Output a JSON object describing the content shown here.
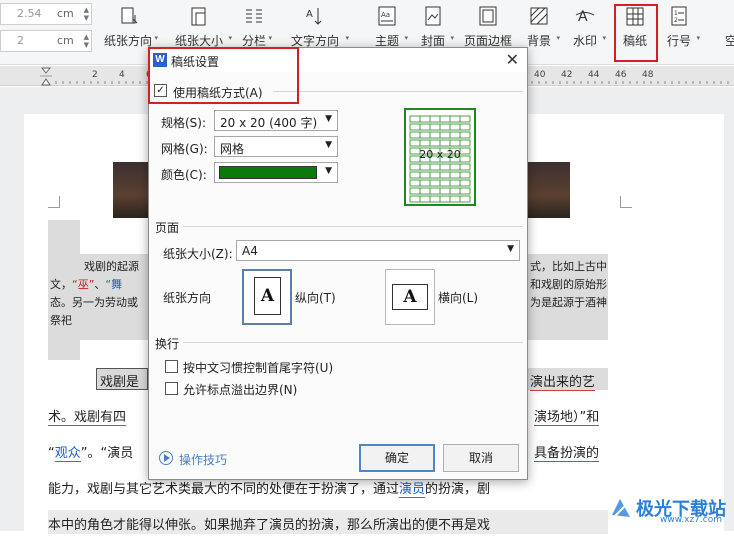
{
  "ribbon": {
    "spin1": {
      "value": "2.54",
      "unit": "cm"
    },
    "spin2": {
      "value": "2",
      "unit": "cm"
    },
    "tools": [
      {
        "label": "纸张方向",
        "icon": "page-orientation-icon",
        "dd": true
      },
      {
        "label": "纸张大小",
        "icon": "page-size-icon",
        "dd": true
      },
      {
        "label": "分栏",
        "icon": "columns-icon",
        "dd": true
      },
      {
        "label": "文字方向",
        "icon": "text-direction-icon",
        "dd": true
      },
      {
        "label": "主题",
        "icon": "theme-icon",
        "dd": true
      },
      {
        "label": "封面",
        "icon": "cover-page-icon",
        "dd": true
      },
      {
        "label": "页面边框",
        "icon": "page-border-icon",
        "dd": false
      },
      {
        "label": "背景",
        "icon": "background-icon",
        "dd": true
      },
      {
        "label": "水印",
        "icon": "watermark-icon",
        "dd": true
      },
      {
        "label": "稿纸",
        "icon": "manuscript-grid-icon",
        "dd": false
      },
      {
        "label": "行号",
        "icon": "line-numbers-icon",
        "dd": true
      },
      {
        "label": "空",
        "icon": "",
        "dd": false
      }
    ]
  },
  "ruler": {
    "numbers_left": [
      "2",
      "4",
      "6",
      "8"
    ],
    "numbers_right": [
      "40",
      "42",
      "44",
      "46",
      "48"
    ]
  },
  "document": {
    "para1_l1_a": "戏剧的起源",
    "para1_l1_b": "式，比如上古中",
    "para1_l2_a": "文，",
    "para1_l2_q1": "“巫”",
    "para1_l2_mid": "、",
    "para1_l2_q2": "“舞",
    "para1_l2_b": "和戏剧的原始形",
    "para1_l3_a": "态。另一为劳动或",
    "para1_l3_b": "为是起源于酒神",
    "para1_l4": "祭祀",
    "line1_a": "戏剧是",
    "line1_b": "演出来的艺",
    "line2_a": "术。戏剧有四",
    "line2_b": "演场地）”和",
    "line3_link": "观众",
    "line3_a": "“",
    "line3_b": "”。“演员",
    "line3_c": "具备扮演的",
    "line4_a": "能力，戏剧与其它艺术类最大的不同的处便在于扮演了，通过",
    "line4_link": "演员",
    "line4_b": "的扮演，剧",
    "line5": "本中的角色才能得以伸张。如果抛弃了演员的扮演，那么所演出的便不再是戏"
  },
  "dialog": {
    "title": "稿纸设置",
    "use_manuscript_label": "使用稿纸方式(A)",
    "use_manuscript_checked": true,
    "spec_label": "规格(S):",
    "spec_value": "20 x 20 (400 字)",
    "grid_label": "网格(G):",
    "grid_value": "网格",
    "color_label": "颜色(C):",
    "color_value": "#0a7a0a",
    "preview_label": "20 x 20",
    "page_section": "页面",
    "paper_size_label": "纸张大小(Z):",
    "paper_size_value": "A4",
    "orientation_label": "纸张方向",
    "portrait_icon_letter": "A",
    "portrait_label": "纵向(T)",
    "landscape_icon_letter": "A",
    "landscape_label": "横向(L)",
    "wrap_section": "换行",
    "opt1_label": "按中文习惯控制首尾字符(U)",
    "opt2_label": "允许标点溢出边界(N)",
    "tips_label": "操作技巧",
    "ok_label": "确定",
    "cancel_label": "取消"
  },
  "watermark": {
    "text": "极光下载站",
    "url": "www.xz7.com"
  },
  "colors": {
    "accent_red": "#d42020",
    "link_blue": "#1a5fd0",
    "grid_green": "#1c8a1c"
  }
}
